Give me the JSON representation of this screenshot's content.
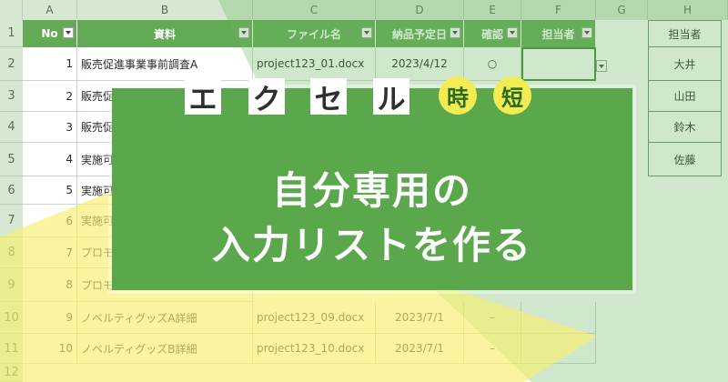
{
  "sheet": {
    "columns": [
      "A",
      "B",
      "C",
      "D",
      "E",
      "F",
      "G",
      "H"
    ],
    "row_numbers": [
      "1",
      "2",
      "3",
      "4",
      "5",
      "6",
      "7",
      "8",
      "9",
      "10",
      "11",
      "12"
    ],
    "table_headers": [
      "No",
      "資料",
      "ファイル名",
      "納品予定日",
      "確認",
      "担当者"
    ],
    "rows": [
      {
        "no": "1",
        "doc": "販売促進事業事前調査A",
        "file": "project123_01.docx",
        "date": "2023/4/12",
        "check": "○",
        "owner": ""
      },
      {
        "no": "2",
        "doc": "販売促進事業事前調",
        "file": "",
        "date": "",
        "check": "",
        "owner": ""
      },
      {
        "no": "3",
        "doc": "販売促",
        "file": "",
        "date": "",
        "check": "",
        "owner": ""
      },
      {
        "no": "4",
        "doc": "実施可",
        "file": "",
        "date": "",
        "check": "",
        "owner": ""
      },
      {
        "no": "5",
        "doc": "実施可",
        "file": "",
        "date": "",
        "check": "",
        "owner": ""
      },
      {
        "no": "6",
        "doc": "実施可",
        "file": "",
        "date": "",
        "check": "",
        "owner": ""
      },
      {
        "no": "7",
        "doc": "プロモ",
        "file": "",
        "date": "",
        "check": "",
        "owner": ""
      },
      {
        "no": "8",
        "doc": "プロモ",
        "file": "",
        "date": "",
        "check": "",
        "owner": ""
      },
      {
        "no": "9",
        "doc": "ノベルティグッズA詳細",
        "file": "project123_09.docx",
        "date": "2023/7/1",
        "check": "–",
        "owner": ""
      },
      {
        "no": "10",
        "doc": "ノベルティグッズB詳細",
        "file": "project123_10.docx",
        "date": "2023/7/1",
        "check": "–",
        "owner": ""
      }
    ],
    "owner_list_header": "担当者",
    "owner_list": [
      "大井",
      "山田",
      "鈴木",
      "佐藤"
    ]
  },
  "banner": {
    "tiles": [
      "エ",
      "ク",
      "セ",
      "ル"
    ],
    "circles": [
      "時",
      "短"
    ],
    "line1": "自分専用の",
    "line2": "入力リストを作る",
    "colors": {
      "green": "#5ba84c",
      "yellow": "#f1ec52",
      "table_header": "#62aa55"
    }
  }
}
